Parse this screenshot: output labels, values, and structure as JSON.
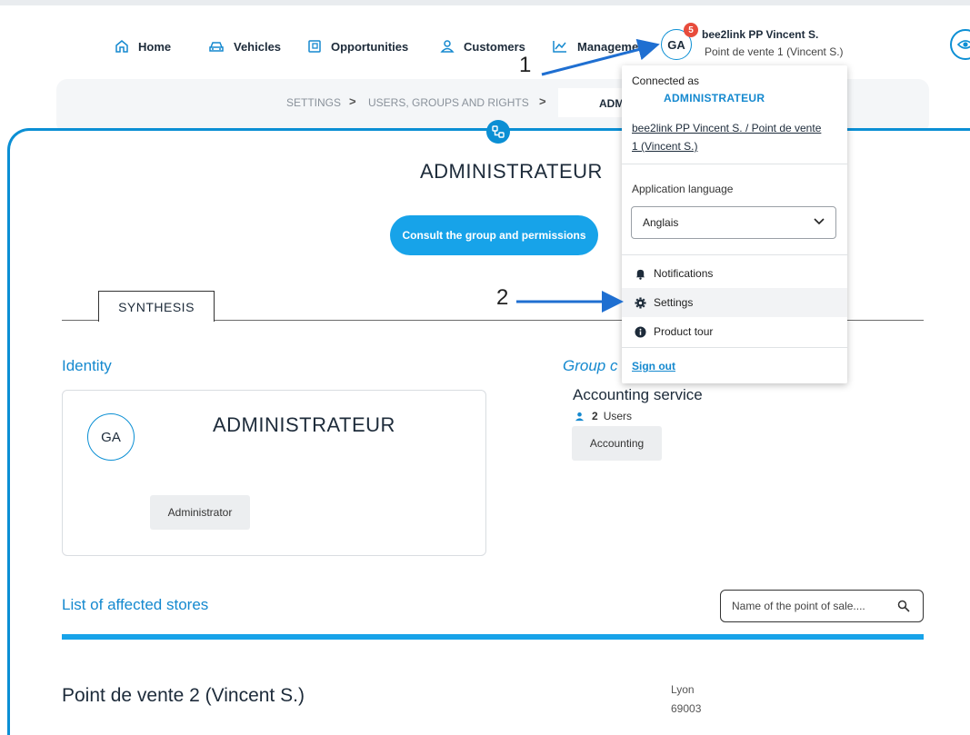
{
  "nav": {
    "items": [
      {
        "label": "Home",
        "icon": "home-icon"
      },
      {
        "label": "Vehicles",
        "icon": "car-icon"
      },
      {
        "label": "Opportunities",
        "icon": "wallet-icon"
      },
      {
        "label": "Customers",
        "icon": "user-icon"
      },
      {
        "label": "Management",
        "icon": "chart-icon"
      }
    ]
  },
  "user": {
    "initials": "GA",
    "notifications": "5",
    "name": "bee2link PP Vincent S.",
    "store": "Point de vente 1 (Vincent S.)"
  },
  "breadcrumb": {
    "settings": "SETTINGS",
    "users": "USERS, GROUPS AND RIGHTS",
    "current": "ADM",
    "separator": ">"
  },
  "main": {
    "title": "ADMINISTRATEUR",
    "consult_button": "Consult the group and permissions",
    "tab_synthesis": "SYNTHESIS"
  },
  "identity": {
    "title": "Identity",
    "initials": "GA",
    "name": "ADMINISTRATEUR",
    "role": "Administrator"
  },
  "group": {
    "title": "Group c",
    "name": "Accounting service",
    "users_count": "2",
    "users_label": "Users",
    "tag": "Accounting"
  },
  "stores": {
    "title": "List of affected stores",
    "search_placeholder": "Name of the point of sale....",
    "items": [
      {
        "name": "Point de vente 2 (Vincent S.)",
        "city": "Lyon",
        "zip": "69003"
      }
    ]
  },
  "dropdown": {
    "connected_as": "Connected as",
    "role": "ADMINISTRATEUR",
    "account_line1": "bee2link PP Vincent S. / Point de vente",
    "account_line2": "1 (Vincent S.)",
    "language_label": "Application language",
    "language_value": "Anglais",
    "notifications": "Notifications",
    "settings": "Settings",
    "product_tour": "Product tour",
    "sign_out": "Sign out"
  },
  "annotations": {
    "step1": "1",
    "step2": "2"
  },
  "colors": {
    "accent": "#0b8fd4",
    "button": "#17a3e9",
    "badge": "#e74c3c",
    "annotation": "#1f6fd1"
  }
}
